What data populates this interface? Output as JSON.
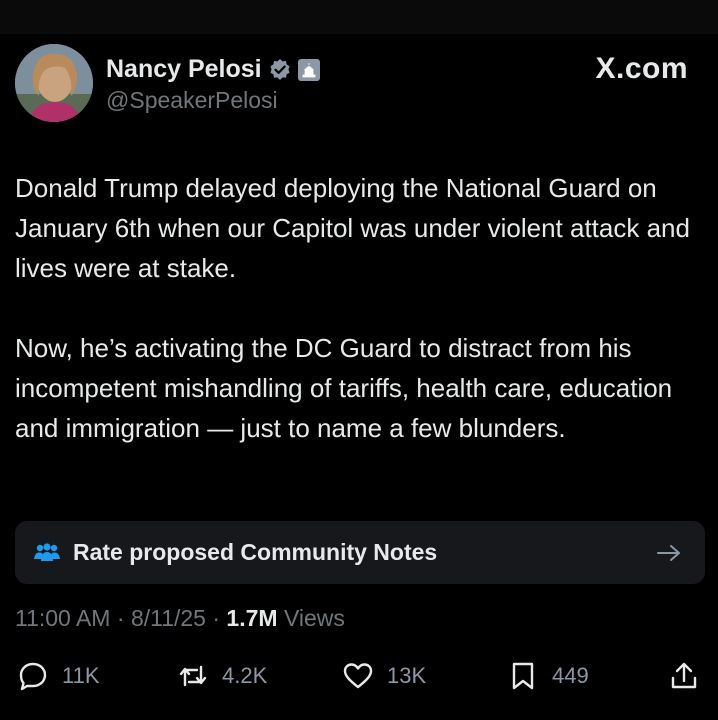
{
  "author": {
    "name": "Nancy Pelosi",
    "handle": "@SpeakerPelosi",
    "verified_icon": "verified-badge-icon",
    "affiliation_icon": "government-capitol-icon"
  },
  "brand": {
    "label": "X.com"
  },
  "post": {
    "paragraphs": [
      "Donald Trump delayed deploying the National Guard on January 6th when our Capitol was under violent attack and lives were at stake.",
      "Now, he’s activating the DC Guard to distract from his incompetent mishandling of tariffs, health care, education and immigration — just to name a few blunders."
    ]
  },
  "community_notes": {
    "label": "Rate proposed Community Notes",
    "icon": "people-icon",
    "arrow_icon": "arrow-right-icon"
  },
  "meta": {
    "time": "11:00 AM",
    "date": "8/11/25",
    "views_count": "1.7M",
    "views_label": "Views",
    "separator": " · "
  },
  "actions": {
    "replies": "11K",
    "reposts": "4.2K",
    "likes": "13K",
    "bookmarks": "449"
  },
  "colors": {
    "background": "#000000",
    "text": "#e7e9ea",
    "secondary": "#71767b",
    "verified": "#8b98a5",
    "card": "#16181c"
  }
}
